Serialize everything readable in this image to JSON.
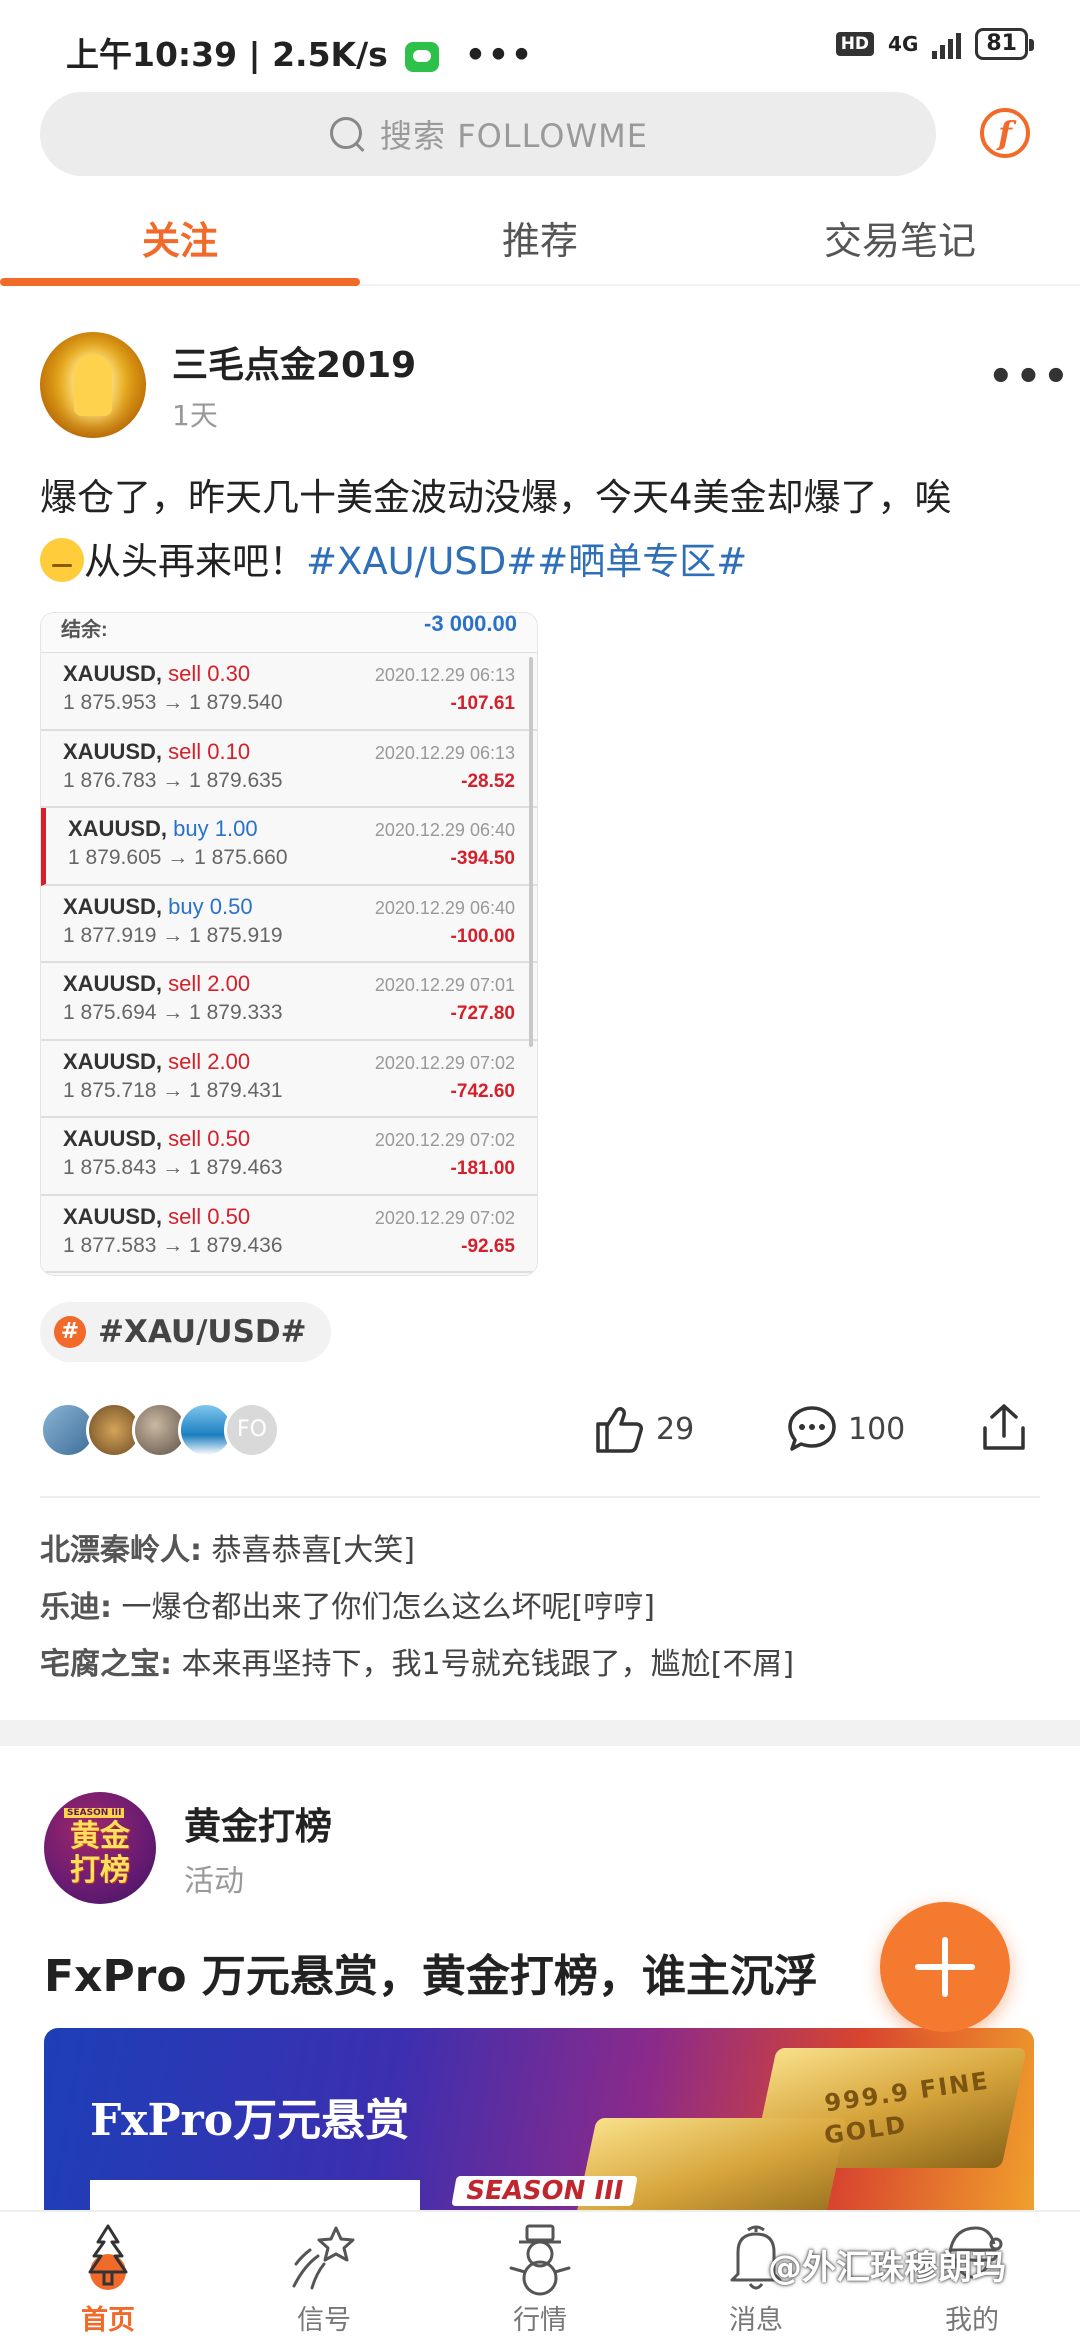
{
  "status_bar": {
    "time": "上午10:39 | 2.5K/s",
    "more": "•••",
    "hd": "HD",
    "network": "4G",
    "battery": "81"
  },
  "search": {
    "placeholder": "搜索 FOLLOWME"
  },
  "header": {
    "logo_letter": "f"
  },
  "tabs": [
    {
      "label": "关注",
      "active": true
    },
    {
      "label": "推荐",
      "active": false
    },
    {
      "label": "交易笔记",
      "active": false
    }
  ],
  "post": {
    "username": "三毛点金2019",
    "time": "1天",
    "more": "•••",
    "text_line1": "爆仓了，昨天几十美金波动没爆，今天4美金却爆了，唉",
    "text_line2": "从头再来吧！",
    "hashtags": "#XAU/USD##晒单专区#",
    "trades_screenshot": {
      "balance_label": "结余:",
      "balance_value": "-3 000.00",
      "rows": [
        {
          "symbol": "XAUUSD,",
          "side": "sell",
          "lots": "0.30",
          "price": "1 875.953 → 1 879.540",
          "date": "2020.12.29 06:13",
          "pl": "-107.61",
          "marked": false
        },
        {
          "symbol": "XAUUSD,",
          "side": "sell",
          "lots": "0.10",
          "price": "1 876.783 → 1 879.635",
          "date": "2020.12.29 06:13",
          "pl": "-28.52",
          "marked": false
        },
        {
          "symbol": "XAUUSD,",
          "side": "buy",
          "lots": "1.00",
          "price": "1 879.605 → 1 875.660",
          "date": "2020.12.29 06:40",
          "pl": "-394.50",
          "marked": true
        },
        {
          "symbol": "XAUUSD,",
          "side": "buy",
          "lots": "0.50",
          "price": "1 877.919 → 1 875.919",
          "date": "2020.12.29 06:40",
          "pl": "-100.00",
          "marked": false
        },
        {
          "symbol": "XAUUSD,",
          "side": "sell",
          "lots": "2.00",
          "price": "1 875.694 → 1 879.333",
          "date": "2020.12.29 07:01",
          "pl": "-727.80",
          "marked": false
        },
        {
          "symbol": "XAUUSD,",
          "side": "sell",
          "lots": "2.00",
          "price": "1 875.718 → 1 879.431",
          "date": "2020.12.29 07:02",
          "pl": "-742.60",
          "marked": false
        },
        {
          "symbol": "XAUUSD,",
          "side": "sell",
          "lots": "0.50",
          "price": "1 875.843 → 1 879.463",
          "date": "2020.12.29 07:02",
          "pl": "-181.00",
          "marked": false
        },
        {
          "symbol": "XAUUSD,",
          "side": "sell",
          "lots": "0.50",
          "price": "1 877.583 → 1 879.436",
          "date": "2020.12.29 07:02",
          "pl": "-92.65",
          "marked": false
        }
      ]
    },
    "topic": {
      "hash": "#",
      "label": "#XAU/USD#"
    },
    "likers_last": "FO",
    "likes": "29",
    "comments_count": "100",
    "comments": [
      {
        "author": "北漂秦岭人:",
        "text": " 恭喜恭喜[大笑]"
      },
      {
        "author": "乐迪:",
        "text": " 一爆仓都出来了你们怎么这么坏呢[哼哼]"
      },
      {
        "author": "宅腐之宝:",
        "text": " 本来再坚持下，我1号就充钱跟了，尴尬[不屑]"
      }
    ]
  },
  "event": {
    "avatar_season": "SEASON III",
    "avatar_text": "黄金打榜",
    "title": "黄金打榜",
    "subtitle": "活动",
    "headline": "FxPro 万元悬赏，黄金打榜，谁主沉浮",
    "banner_title": "FxPro万元悬赏",
    "banner_season": "SEASON III",
    "banner_gold_text": "GOLD",
    "banner_fine_text": "999.9 FINE"
  },
  "bottom_nav": [
    {
      "label": "首页",
      "icon": "christmas-tree-icon",
      "active": true
    },
    {
      "label": "信号",
      "icon": "shooting-star-icon",
      "active": false
    },
    {
      "label": "行情",
      "icon": "snowman-icon",
      "active": false
    },
    {
      "label": "消息",
      "icon": "bell-icon",
      "active": false
    },
    {
      "label": "我的",
      "icon": "santa-icon",
      "active": false
    }
  ],
  "watermark": "@外汇珠穆朗玛",
  "colors": {
    "accent": "#f26a2a",
    "link": "#2f6fb8",
    "loss": "#d4202a",
    "buy": "#2a72c9"
  }
}
